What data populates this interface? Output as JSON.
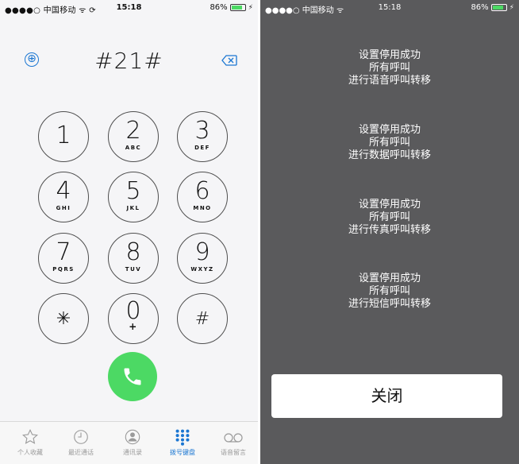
{
  "left": {
    "status": {
      "carrier": "●●●●○ 中国移动 ᯤ ⟳",
      "time": "15:18",
      "battery": "86%",
      "battery_level": 0.86
    },
    "dialed_number": "#21#",
    "add_symbol": "⊕",
    "keys": [
      {
        "digit": "1",
        "letters": ""
      },
      {
        "digit": "2",
        "letters": "ABC"
      },
      {
        "digit": "3",
        "letters": "DEF"
      },
      {
        "digit": "4",
        "letters": "GHI"
      },
      {
        "digit": "5",
        "letters": "JKL"
      },
      {
        "digit": "6",
        "letters": "MNO"
      },
      {
        "digit": "7",
        "letters": "PQRS"
      },
      {
        "digit": "8",
        "letters": "TUV"
      },
      {
        "digit": "9",
        "letters": "WXYZ"
      },
      {
        "digit": "✳",
        "letters": ""
      },
      {
        "digit": "0",
        "letters": "+"
      },
      {
        "digit": "#",
        "letters": ""
      }
    ],
    "tabs": [
      {
        "label": "个人收藏",
        "icon": "star-icon"
      },
      {
        "label": "最近通话",
        "icon": "clock-icon"
      },
      {
        "label": "通讯录",
        "icon": "contacts-icon"
      },
      {
        "label": "拨号键盘",
        "icon": "keypad-icon",
        "active": true
      },
      {
        "label": "语音留言",
        "icon": "voicemail-icon"
      }
    ],
    "accent_color": "#1a76d2",
    "call_color": "#4cd964"
  },
  "right": {
    "status": {
      "carrier": "●●●●○ 中国移动 ᯤ",
      "time": "15:18",
      "battery": "86%",
      "battery_level": 0.86
    },
    "messages": [
      [
        "设置停用成功",
        "所有呼叫",
        "进行语音呼叫转移"
      ],
      [
        "设置停用成功",
        "所有呼叫",
        "进行数据呼叫转移"
      ],
      [
        "设置停用成功",
        "所有呼叫",
        "进行传真呼叫转移"
      ],
      [
        "设置停用成功",
        "所有呼叫",
        "进行短信呼叫转移"
      ]
    ],
    "close_label": "关闭"
  }
}
